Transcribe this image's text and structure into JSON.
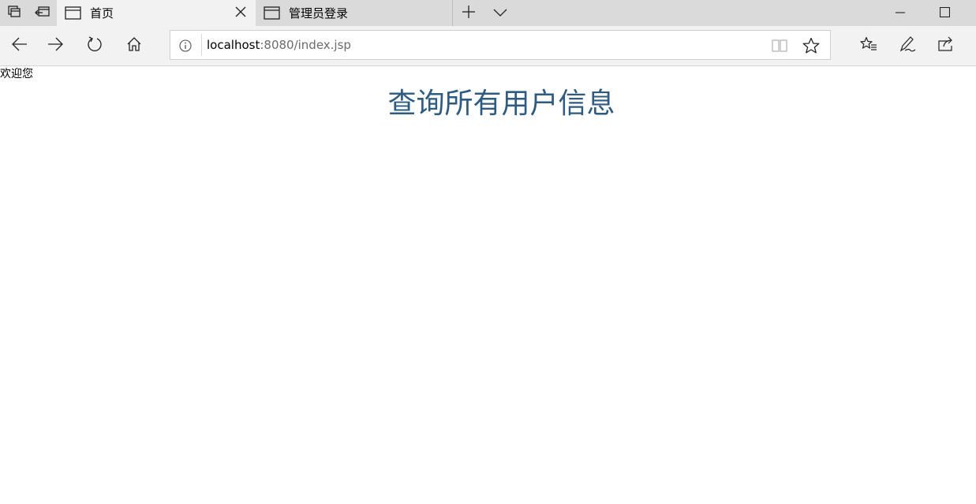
{
  "tabs": [
    {
      "label": "首页",
      "active": true
    },
    {
      "label": "管理员登录",
      "active": false
    }
  ],
  "address_bar": {
    "url_host": "localhost",
    "url_rest": ":8080/index.jsp"
  },
  "page": {
    "welcome_text": "欢迎您",
    "heading": "查询所有用户信息"
  },
  "colors": {
    "heading": "#2e5b82",
    "tabstrip": "#dadada",
    "toolbar": "#f2f2f2"
  },
  "icons": [
    "tab-manager-icon",
    "set-aside-tabs-icon",
    "tab-page-icon",
    "close-icon",
    "new-tab-icon",
    "chevron-down-icon",
    "minimize-icon",
    "maximize-icon",
    "back-arrow-icon",
    "forward-arrow-icon",
    "refresh-icon",
    "home-icon",
    "info-icon",
    "reading-view-icon",
    "favorite-star-icon",
    "favorites-hub-icon",
    "pen-icon",
    "share-icon"
  ]
}
